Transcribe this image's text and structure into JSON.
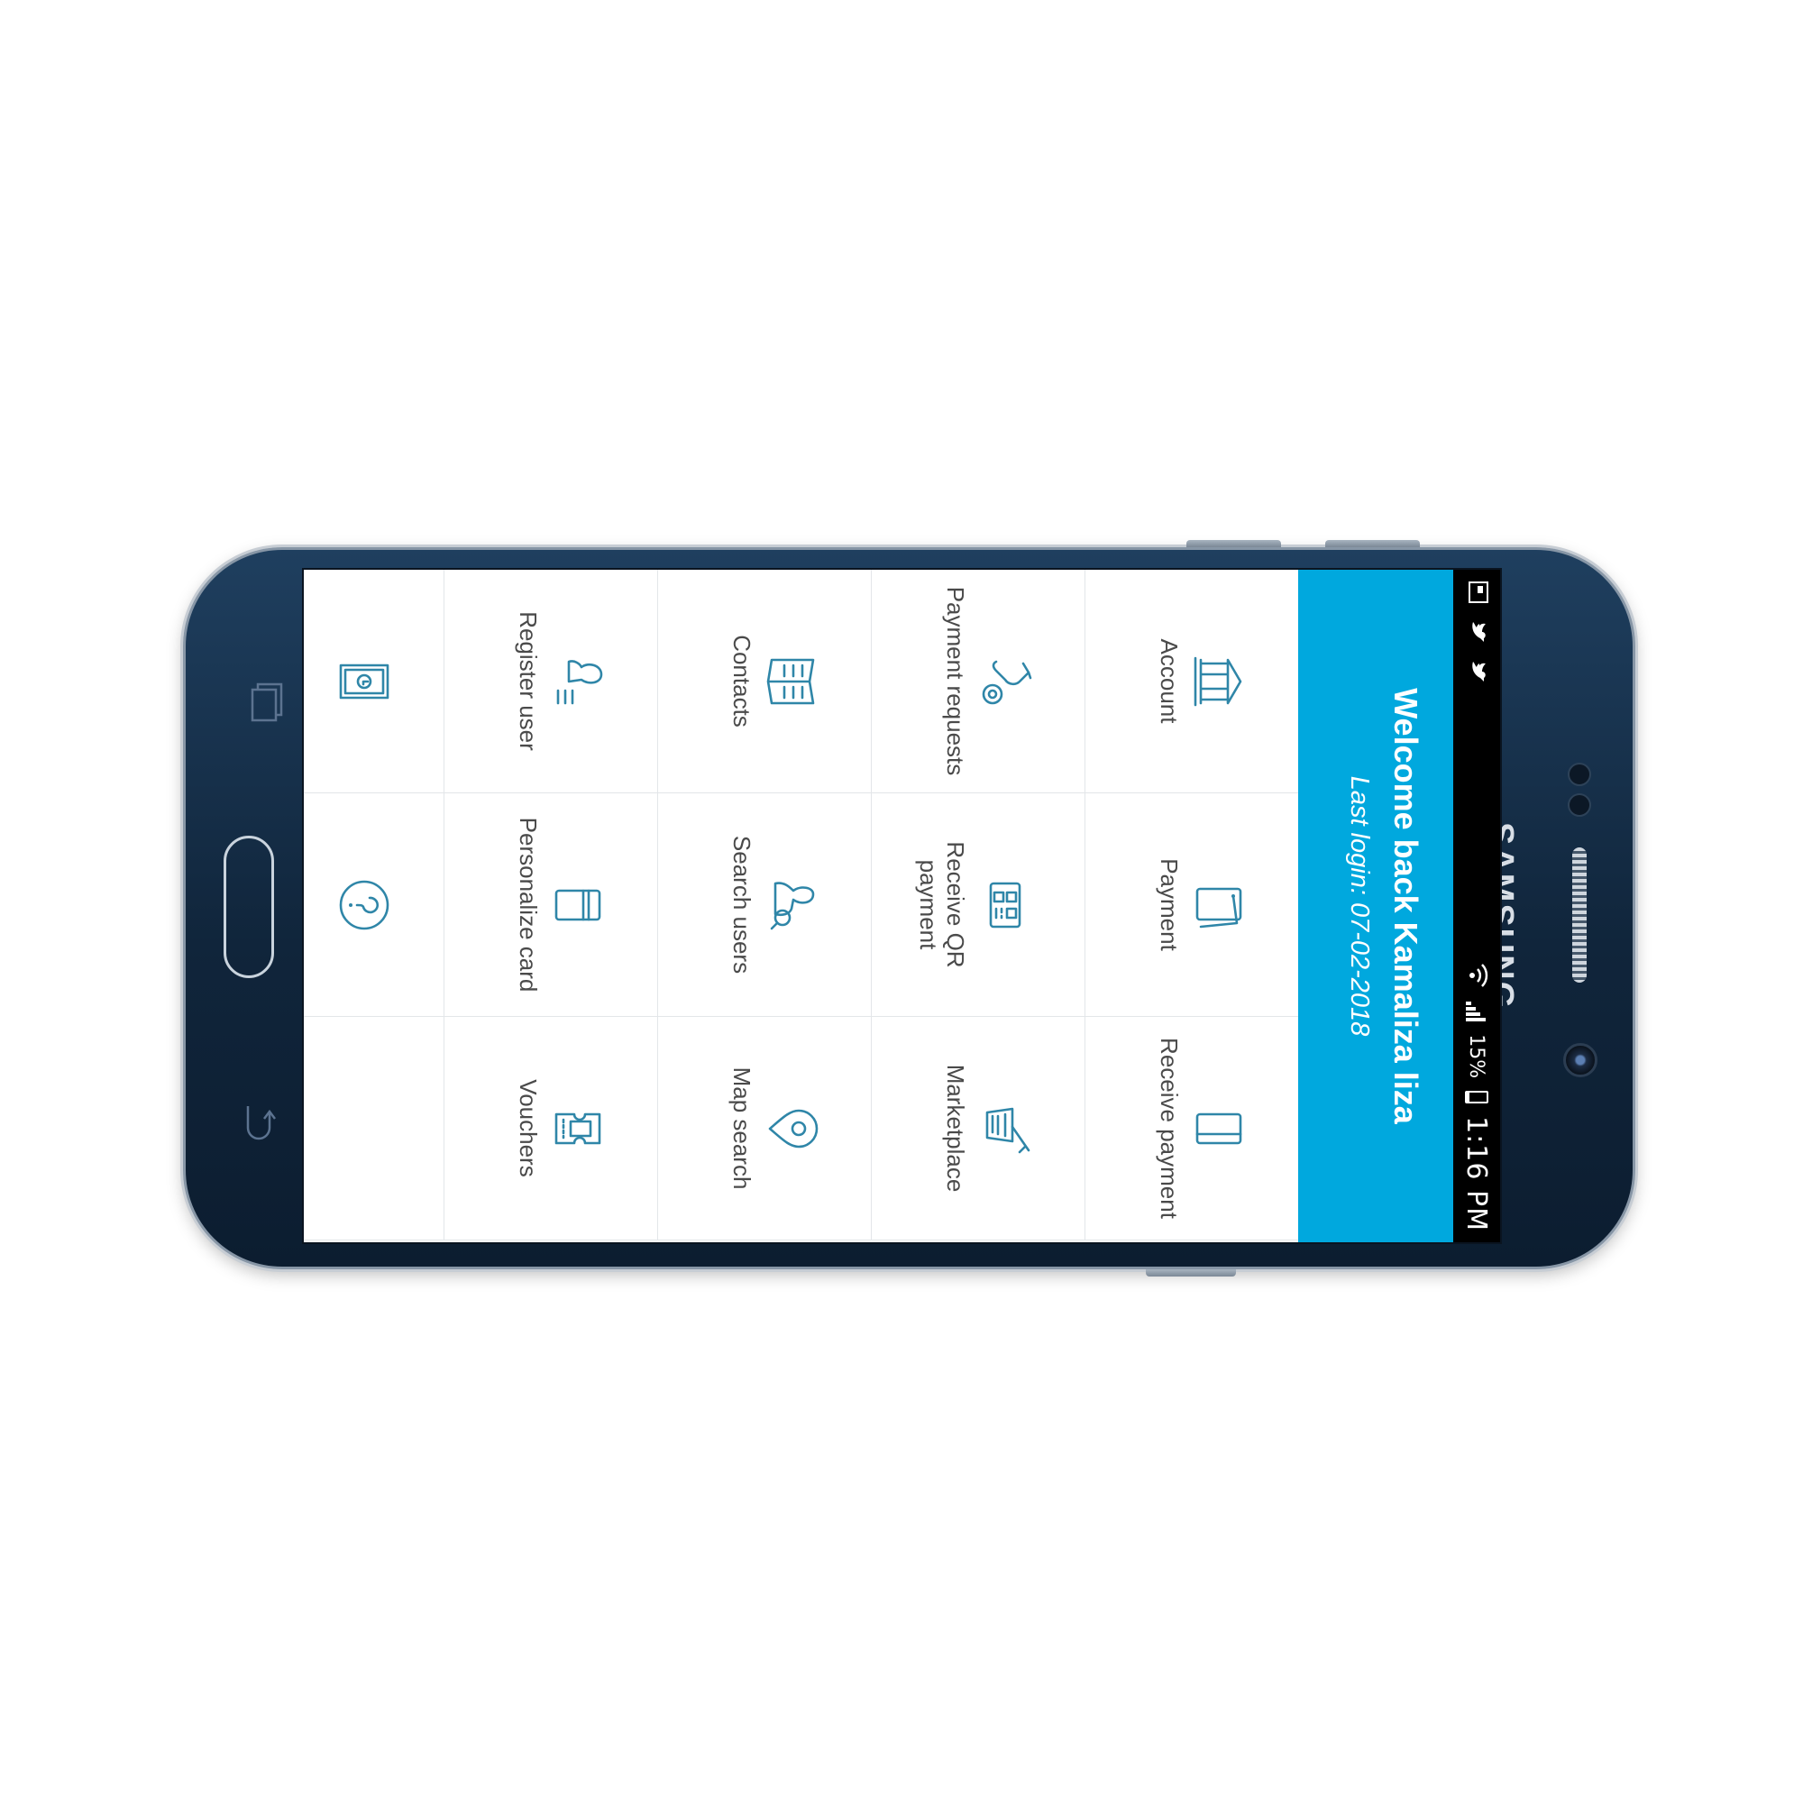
{
  "device": {
    "brand": "SAMSUNG"
  },
  "status_bar": {
    "time": "1:16 PM",
    "battery": "15%"
  },
  "header": {
    "welcome": "Welcome back Kamaliza liza",
    "last_login": "Last login: 07-02-2018",
    "color": "#00a8de"
  },
  "accent_color": "#2f86a8",
  "menu": [
    {
      "label": "Account",
      "icon": "bank-icon"
    },
    {
      "label": "Payment",
      "icon": "payment-cards-icon"
    },
    {
      "label": "Receive payment",
      "icon": "card-icon"
    },
    {
      "label": "Payment requests",
      "icon": "hand-coin-icon"
    },
    {
      "label": "Receive QR payment",
      "icon": "qr-code-icon"
    },
    {
      "label": "Marketplace",
      "icon": "shopping-basket-icon"
    },
    {
      "label": "Contacts",
      "icon": "address-book-icon"
    },
    {
      "label": "Search users",
      "icon": "search-users-icon"
    },
    {
      "label": "Map search",
      "icon": "map-pin-icon"
    },
    {
      "label": "Register user",
      "icon": "register-user-icon"
    },
    {
      "label": "Personalize card",
      "icon": "personalize-card-icon"
    },
    {
      "label": "Vouchers",
      "icon": "voucher-icon"
    },
    {
      "label": "",
      "icon": "banknote-icon"
    },
    {
      "label": "",
      "icon": "help-icon"
    }
  ]
}
